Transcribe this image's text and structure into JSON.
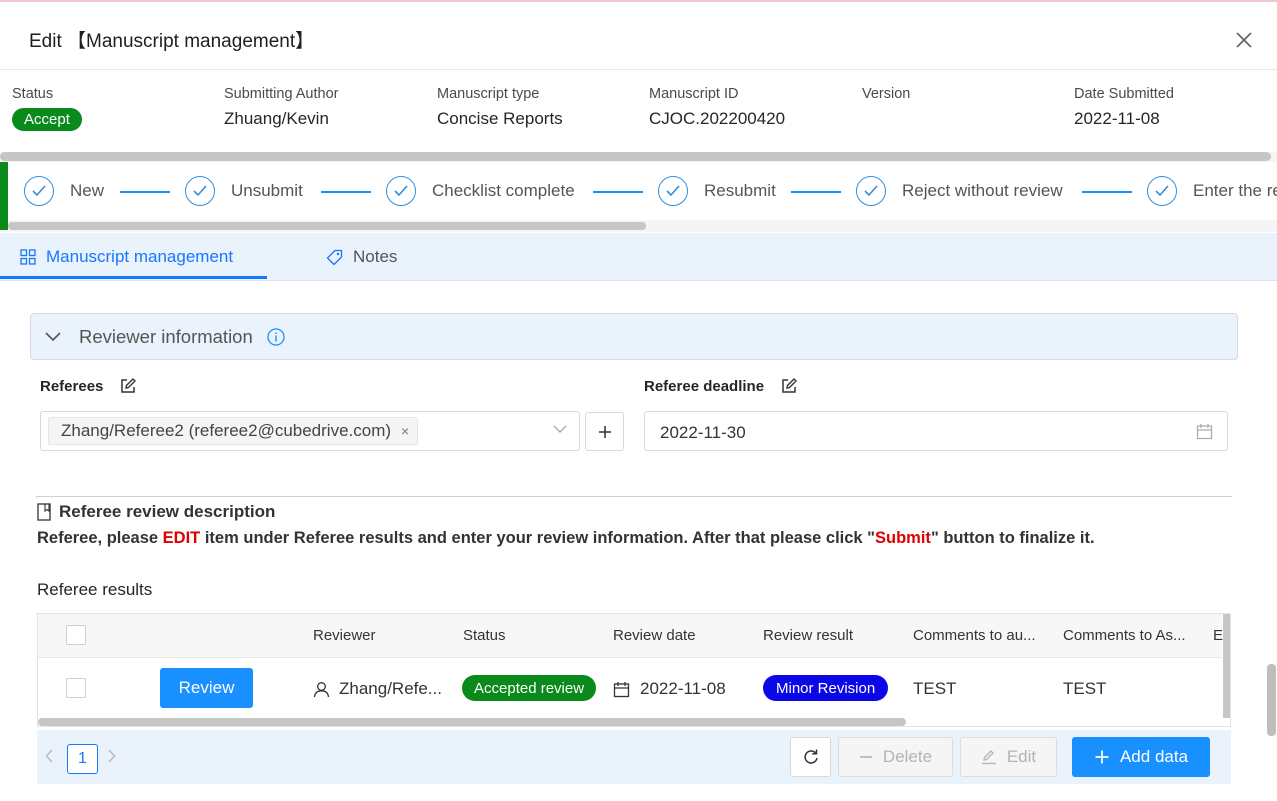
{
  "dialog": {
    "title": "Edit 【Manuscript management】"
  },
  "meta": {
    "status_label": "Status",
    "status_value": "Accept",
    "author_label": "Submitting Author",
    "author_value": "Zhuang/Kevin",
    "type_label": "Manuscript type",
    "type_value": "Concise Reports",
    "id_label": "Manuscript ID",
    "id_value": "CJOC.202200420",
    "version_label": "Version",
    "version_value": "",
    "date_label": "Date Submitted",
    "date_value": "2022-11-08"
  },
  "steps": [
    {
      "label": "New"
    },
    {
      "label": "Unsubmit"
    },
    {
      "label": "Checklist complete"
    },
    {
      "label": "Resubmit"
    },
    {
      "label": "Reject without review"
    },
    {
      "label": "Enter the re"
    }
  ],
  "tabs": [
    {
      "label": "Manuscript management",
      "icon": "grid-icon",
      "active": true
    },
    {
      "label": "Notes",
      "icon": "tag-icon",
      "active": false
    }
  ],
  "panel": {
    "title": "Reviewer information"
  },
  "referees": {
    "label": "Referees",
    "tag": "Zhang/Referee2 (referee2@cubedrive.com)",
    "tag_close": "×"
  },
  "deadline": {
    "label": "Referee deadline",
    "value": "2022-11-30"
  },
  "description": {
    "title": "Referee review description",
    "part1": "Referee, please ",
    "edit_word": "EDIT",
    "part2": " item under Referee results and enter your review information. After that please click \"",
    "submit_word": "Submit",
    "part3": "\" button to finalize it."
  },
  "results": {
    "title": "Referee results",
    "columns": [
      "Reviewer",
      "Status",
      "Review date",
      "Review result",
      "Comments to au...",
      "Comments to As...",
      "E"
    ],
    "rows": [
      {
        "action": "Review",
        "reviewer": "Zhang/Refe...",
        "status": "Accepted review",
        "review_date": "2022-11-08",
        "review_result": "Minor Revision",
        "comments_author": "TEST",
        "comments_assoc": "TEST"
      }
    ]
  },
  "footer": {
    "page": "1",
    "delete_label": "Delete",
    "edit_label": "Edit",
    "add_label": "Add data"
  },
  "colors": {
    "primary": "#1890ff",
    "success": "#0a8a1b",
    "minor_revision": "#0a08e6",
    "highlight_red": "#e00000"
  }
}
